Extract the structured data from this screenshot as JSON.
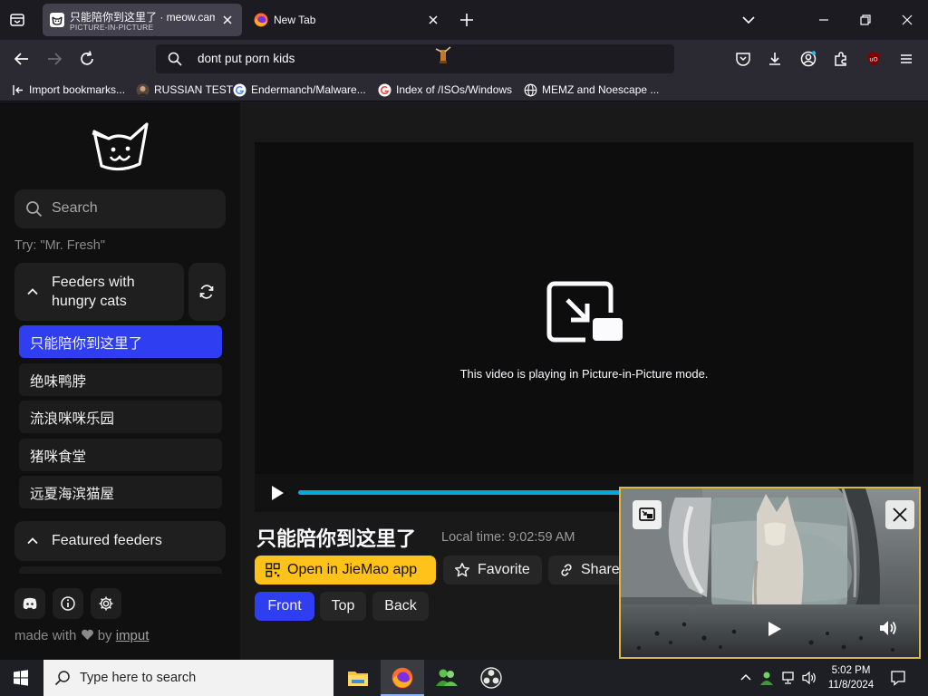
{
  "browser": {
    "tabs": [
      {
        "title": "只能陪你到这里了 · meow.camera",
        "subtitle": "PICTURE-IN-PICTURE",
        "active": true
      },
      {
        "title": "New Tab",
        "active": false
      }
    ],
    "address": {
      "value": "dont put porn kids"
    },
    "bookmarks": [
      {
        "label": "Import bookmarks...",
        "icon": "import-icon"
      },
      {
        "label": "RUSSIAN TEST",
        "icon": "profile-photo-icon"
      },
      {
        "label": "Endermanch/Malware...",
        "icon": "google-icon"
      },
      {
        "label": "Index of /ISOs/Windows",
        "icon": "google-icon"
      },
      {
        "label": "MEMZ and Noescape ...",
        "icon": "globe-icon"
      }
    ]
  },
  "sidebar": {
    "search_placeholder": "Search",
    "try_hint": "Try: \"Mr. Fresh\"",
    "group_hungry": "Feeders with hungry cats",
    "feeders": [
      {
        "name": "只能陪你到这里了",
        "selected": true
      },
      {
        "name": "绝味鸭脖",
        "selected": false
      },
      {
        "name": "流浪咪咪乐园",
        "selected": false
      },
      {
        "name": "猪咪食堂",
        "selected": false
      },
      {
        "name": "远夏海滨猫屋",
        "selected": false
      }
    ],
    "group_featured": "Featured feeders",
    "footer": {
      "made_with": "made with",
      "by": "by",
      "author": "imput"
    }
  },
  "player": {
    "pip_message": "This video is playing in Picture-in-Picture mode.",
    "progress": 0.605
  },
  "stream": {
    "title": "只能陪你到这里了",
    "local_time": "Local time: 9:02:59 AM",
    "open_app": "Open in JieMao app",
    "favorite": "Favorite",
    "share": "Share",
    "views": [
      {
        "label": "Front",
        "active": true
      },
      {
        "label": "Top",
        "active": false
      },
      {
        "label": "Back",
        "active": false
      }
    ]
  },
  "taskbar": {
    "search_placeholder": "Type here to search",
    "time": "5:02 PM",
    "date": "11/8/2024"
  },
  "colors": {
    "accent_blue": "#2f3ef0",
    "open_app_yellow": "#ffc21a",
    "progress_cyan": "#0ea5dd",
    "pip_border": "#d8b84a"
  }
}
